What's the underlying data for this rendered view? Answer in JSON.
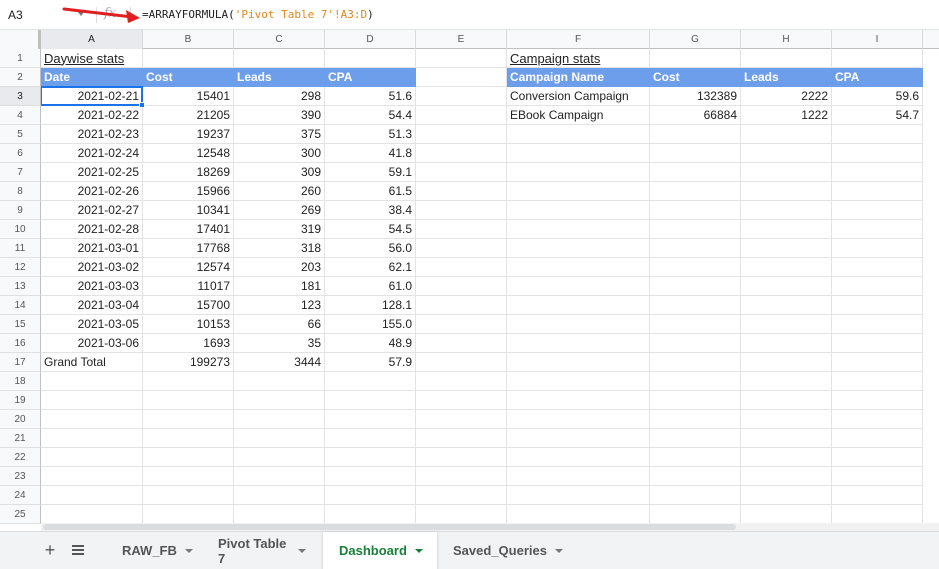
{
  "formula_bar": {
    "cell_ref": "A3",
    "fx_symbol": "fx",
    "formula_fn": "=ARRAYFORMULA(",
    "formula_arg": "'Pivot Table 7'!A3:D",
    "formula_close": ")"
  },
  "columns": [
    "A",
    "B",
    "C",
    "D",
    "E",
    "F",
    "G",
    "H",
    "I"
  ],
  "rows": [
    "1",
    "2",
    "3",
    "4",
    "5",
    "6",
    "7",
    "8",
    "9",
    "10",
    "11",
    "12",
    "13",
    "14",
    "15",
    "16",
    "17",
    "18",
    "19",
    "20",
    "21",
    "22",
    "23",
    "24",
    "25"
  ],
  "daywise": {
    "title": "Daywise stats",
    "headers": [
      "Date",
      "Cost",
      "Leads",
      "CPA"
    ],
    "data": [
      [
        "2021-02-21",
        "15401",
        "298",
        "51.6"
      ],
      [
        "2021-02-22",
        "21205",
        "390",
        "54.4"
      ],
      [
        "2021-02-23",
        "19237",
        "375",
        "51.3"
      ],
      [
        "2021-02-24",
        "12548",
        "300",
        "41.8"
      ],
      [
        "2021-02-25",
        "18269",
        "309",
        "59.1"
      ],
      [
        "2021-02-26",
        "15966",
        "260",
        "61.5"
      ],
      [
        "2021-02-27",
        "10341",
        "269",
        "38.4"
      ],
      [
        "2021-02-28",
        "17401",
        "319",
        "54.5"
      ],
      [
        "2021-03-01",
        "17768",
        "318",
        "56.0"
      ],
      [
        "2021-03-02",
        "12574",
        "203",
        "62.1"
      ],
      [
        "2021-03-03",
        "11017",
        "181",
        "61.0"
      ],
      [
        "2021-03-04",
        "15700",
        "123",
        "128.1"
      ],
      [
        "2021-03-05",
        "10153",
        "66",
        "155.0"
      ],
      [
        "2021-03-06",
        "1693",
        "35",
        "48.9"
      ]
    ],
    "total": [
      "Grand Total",
      "199273",
      "3444",
      "57.9"
    ]
  },
  "campaign": {
    "title": "Campaign stats",
    "headers": [
      "Campaign Name",
      "Cost",
      "Leads",
      "CPA"
    ],
    "data": [
      [
        "Conversion Campaign",
        "132389",
        "2222",
        "59.6"
      ],
      [
        "EBook Campaign",
        "66884",
        "1222",
        "54.7"
      ]
    ]
  },
  "sheet_tabs": {
    "add_label": "+",
    "tabs": [
      {
        "label": "RAW_FB",
        "active": false
      },
      {
        "label": "Pivot Table 7",
        "active": false
      },
      {
        "label": "Dashboard",
        "active": true
      },
      {
        "label": "Saved_Queries",
        "active": false
      }
    ]
  },
  "colors": {
    "header_fill": "#6d9eeb",
    "selection": "#1a73e8",
    "active_tab": "#188038",
    "annotation_arrow": "#e02020",
    "formula_string": "#e2861f"
  }
}
